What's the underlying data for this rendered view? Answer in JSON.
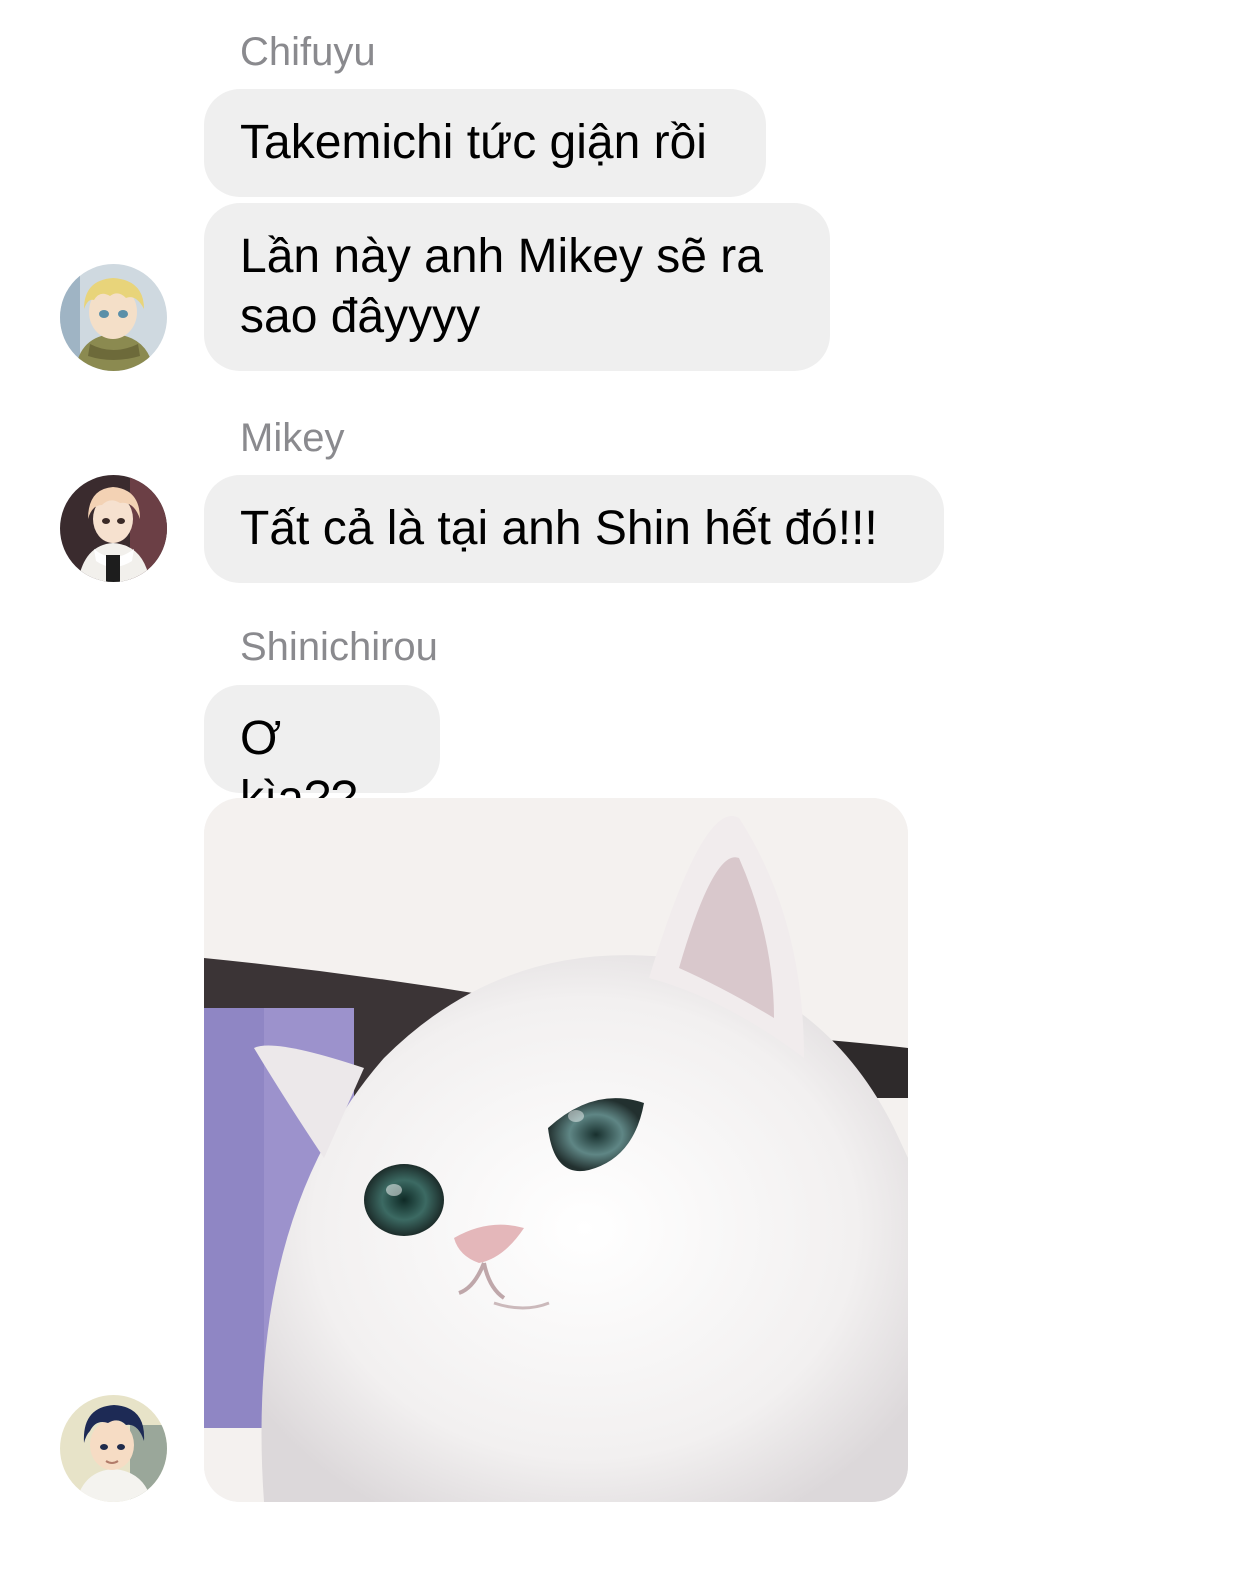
{
  "messages": [
    {
      "sender": "Chifuyu",
      "texts": [
        "Takemichi tức giận rồi",
        "Lần này anh Mikey sẽ ra sao đâyyyy"
      ]
    },
    {
      "sender": "Mikey",
      "texts": [
        "Tất cả là tại anh Shin hết đó!!!"
      ]
    },
    {
      "sender": "Shinichirou",
      "texts": [
        "Ơ kìa??"
      ],
      "attachment": "cat-photo"
    }
  ],
  "colors": {
    "bubble": "#efefef",
    "sender_name": "#8a8a8e",
    "text": "#000000"
  }
}
